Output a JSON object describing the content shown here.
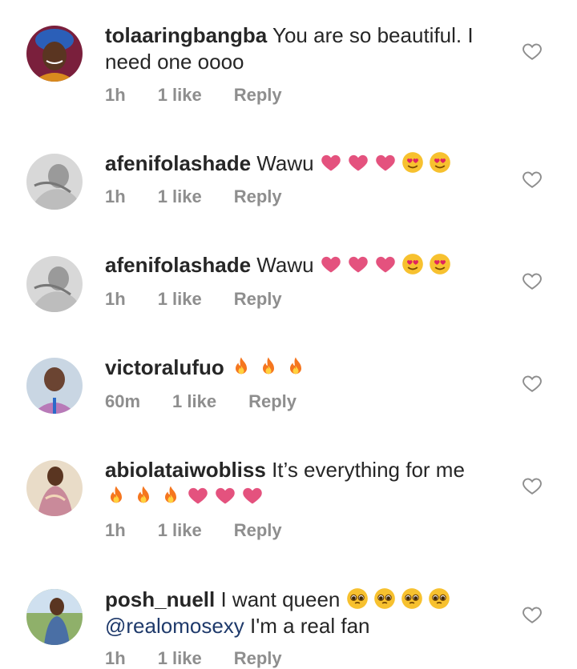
{
  "colors": {
    "like_heart": "#e4527e",
    "meta_text": "#8e8e8e",
    "mention": "#1f3a6b"
  },
  "comments": [
    {
      "username": "tolaaringbangba",
      "text": "You are so beautiful. I need one oooo",
      "emoji": [],
      "time": "1h",
      "likes": "1 like",
      "reply": "Reply",
      "avatar": "avatar-woman-headwrap"
    },
    {
      "username": "afenifolashade",
      "text": "Wawu",
      "emoji": [
        "heart",
        "heart",
        "heart",
        "heart-eyes",
        "heart-eyes"
      ],
      "time": "1h",
      "likes": "1 like",
      "reply": "Reply",
      "avatar": "avatar-grayscale"
    },
    {
      "username": "afenifolashade",
      "text": "Wawu",
      "emoji": [
        "heart",
        "heart",
        "heart",
        "heart-eyes",
        "heart-eyes"
      ],
      "time": "1h",
      "likes": "1 like",
      "reply": "Reply",
      "avatar": "avatar-grayscale"
    },
    {
      "username": "victoralufuo",
      "text": "",
      "emoji": [
        "fire",
        "fire",
        "fire"
      ],
      "time": "60m",
      "likes": "1 like",
      "reply": "Reply",
      "avatar": "avatar-man"
    },
    {
      "username": "abiolataiwobliss",
      "text": "It’s everything for me",
      "emoji": [
        "fire",
        "fire",
        "fire",
        "heart",
        "heart",
        "heart"
      ],
      "time": "1h",
      "likes": "1 like",
      "reply": "Reply",
      "avatar": "avatar-woman-dress"
    },
    {
      "username": "posh_nuell",
      "text": "I want queen",
      "emoji": [
        "pleading",
        "pleading",
        "pleading",
        "pleading"
      ],
      "mention": "@realomosexy",
      "text2": " I'm a real fan",
      "time": "1h",
      "likes": "1 like",
      "reply": "Reply",
      "avatar": "avatar-person-outdoor"
    }
  ]
}
